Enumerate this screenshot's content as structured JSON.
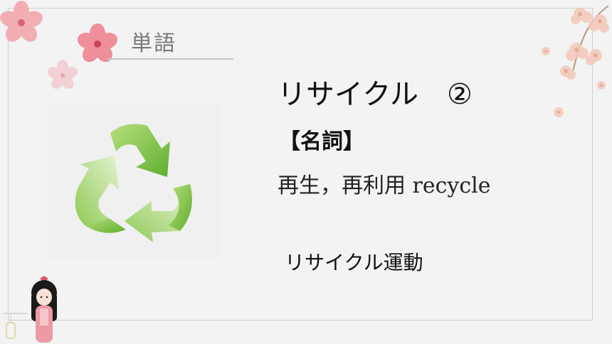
{
  "slide": {
    "section_label": "単語",
    "word": "リサイクル",
    "accent": "②",
    "part_of_speech": "【名詞】",
    "meaning": "再生，再利用 recycle",
    "example": "リサイクル運動"
  },
  "icons": {
    "recycle": "recycle-icon",
    "decor": [
      "cherry-blossom-icon",
      "kokeshi-doll-icon",
      "lantern-icon"
    ]
  },
  "colors": {
    "background": "#f3f3f3",
    "frame": "#cfcfcf",
    "label_gray": "#7a7a7a",
    "recycle_green": "#7cc243",
    "blossom_pink": "#f2a7ad"
  }
}
